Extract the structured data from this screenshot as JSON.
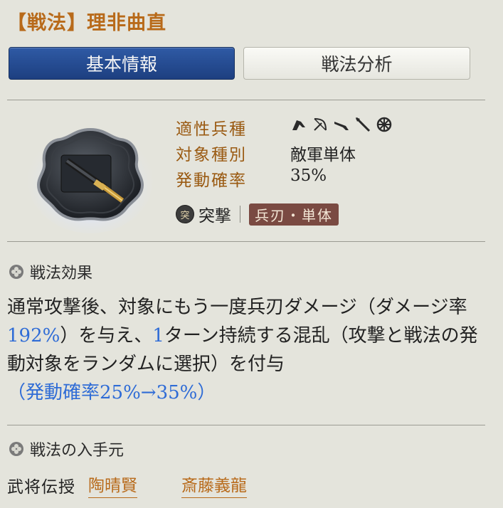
{
  "header": {
    "title": "【戦法】理非曲直"
  },
  "tabs": {
    "basic_info": "基本情報",
    "analysis": "戦法分析"
  },
  "info": {
    "aptitude_label": "適性兵種",
    "target_label": "対象種別",
    "target_value": "敵軍単体",
    "chance_label": "発動確率",
    "chance_value": "35%",
    "troop_icons": [
      "cavalry-icon",
      "bow-icon",
      "gun-icon",
      "spear-icon",
      "wheel-icon"
    ]
  },
  "tactic_tags": {
    "type_icon_char": "突",
    "type_label": "突撃",
    "damage_badge": "兵刃・単体"
  },
  "effect": {
    "title": "戦法効果",
    "text_part1": "通常攻撃後、対象にもう一度兵刃ダメージ（ダメージ率",
    "rate1": "192%",
    "text_part2": "）を与え、",
    "turns": "1",
    "text_part3": "ターン持続する混乱（攻撃と戦法の発動対象をランダムに選択）を付与",
    "upgrade": "（発動確率25%→35%）"
  },
  "source": {
    "title": "戦法の入手元",
    "label": "武将伝授",
    "generals": [
      "陶晴賢",
      "斎藤義龍"
    ]
  },
  "colors": {
    "title": "#b86a1a",
    "tab_active": "#2f5aa5",
    "highlight": "#2f6cd6",
    "badge": "#7a4a42",
    "link": "#b86a1a"
  }
}
